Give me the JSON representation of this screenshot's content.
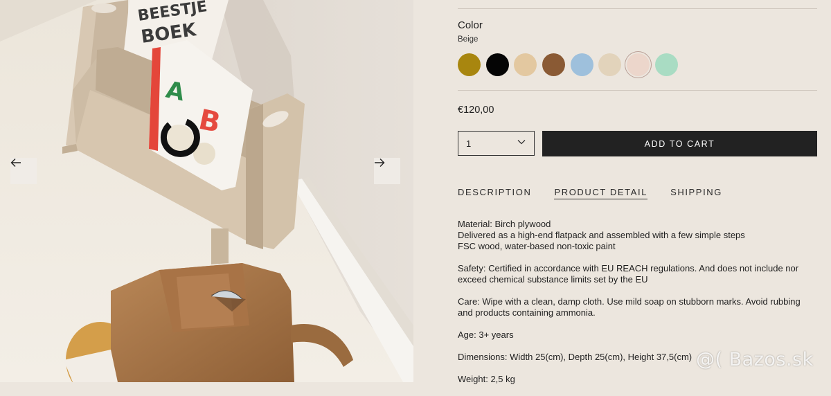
{
  "gallery": {
    "prev_icon": "arrow-left-icon",
    "next_icon": "arrow-right-icon",
    "book_letters": "ABC"
  },
  "product": {
    "color_label": "Color",
    "selected_color": "Beige",
    "swatches": [
      {
        "name": "mustard",
        "color": "#a8860f"
      },
      {
        "name": "black",
        "color": "#050505"
      },
      {
        "name": "natural",
        "color": "#e3c8a0"
      },
      {
        "name": "brown",
        "color": "#8a5a34"
      },
      {
        "name": "blue",
        "color": "#9ec0dc"
      },
      {
        "name": "beige-wood",
        "color": "#e2d3bb"
      },
      {
        "name": "pink",
        "color": "#ecd6cb"
      },
      {
        "name": "mint",
        "color": "#a9dcc3"
      }
    ],
    "price": "€120,00",
    "quantity": "1",
    "add_to_cart": "ADD TO CART"
  },
  "tabs": [
    {
      "label": "DESCRIPTION",
      "active": false
    },
    {
      "label": "PRODUCT DETAIL",
      "active": true
    },
    {
      "label": "SHIPPING",
      "active": false
    }
  ],
  "details": {
    "material": "Material: Birch plywood",
    "delivery": "Delivered as a high-end flatpack and assembled with a few simple steps",
    "fsc": "FSC wood, water-based non-toxic paint",
    "safety": "Safety: Certified in accordance with EU REACH regulations. And does not include nor exceed chemical substance limits set by the EU",
    "care": "Care: Wipe with a clean, damp cloth. Use mild soap on stubborn marks. Avoid rubbing and products containing ammonia.",
    "age": "Age: 3+ years",
    "dimensions": "Dimensions: Width 25(cm), Depth 25(cm), Height 37,5(cm)",
    "weight": "Weight: 2,5 kg"
  },
  "watermark": "@( Bazos.sk"
}
